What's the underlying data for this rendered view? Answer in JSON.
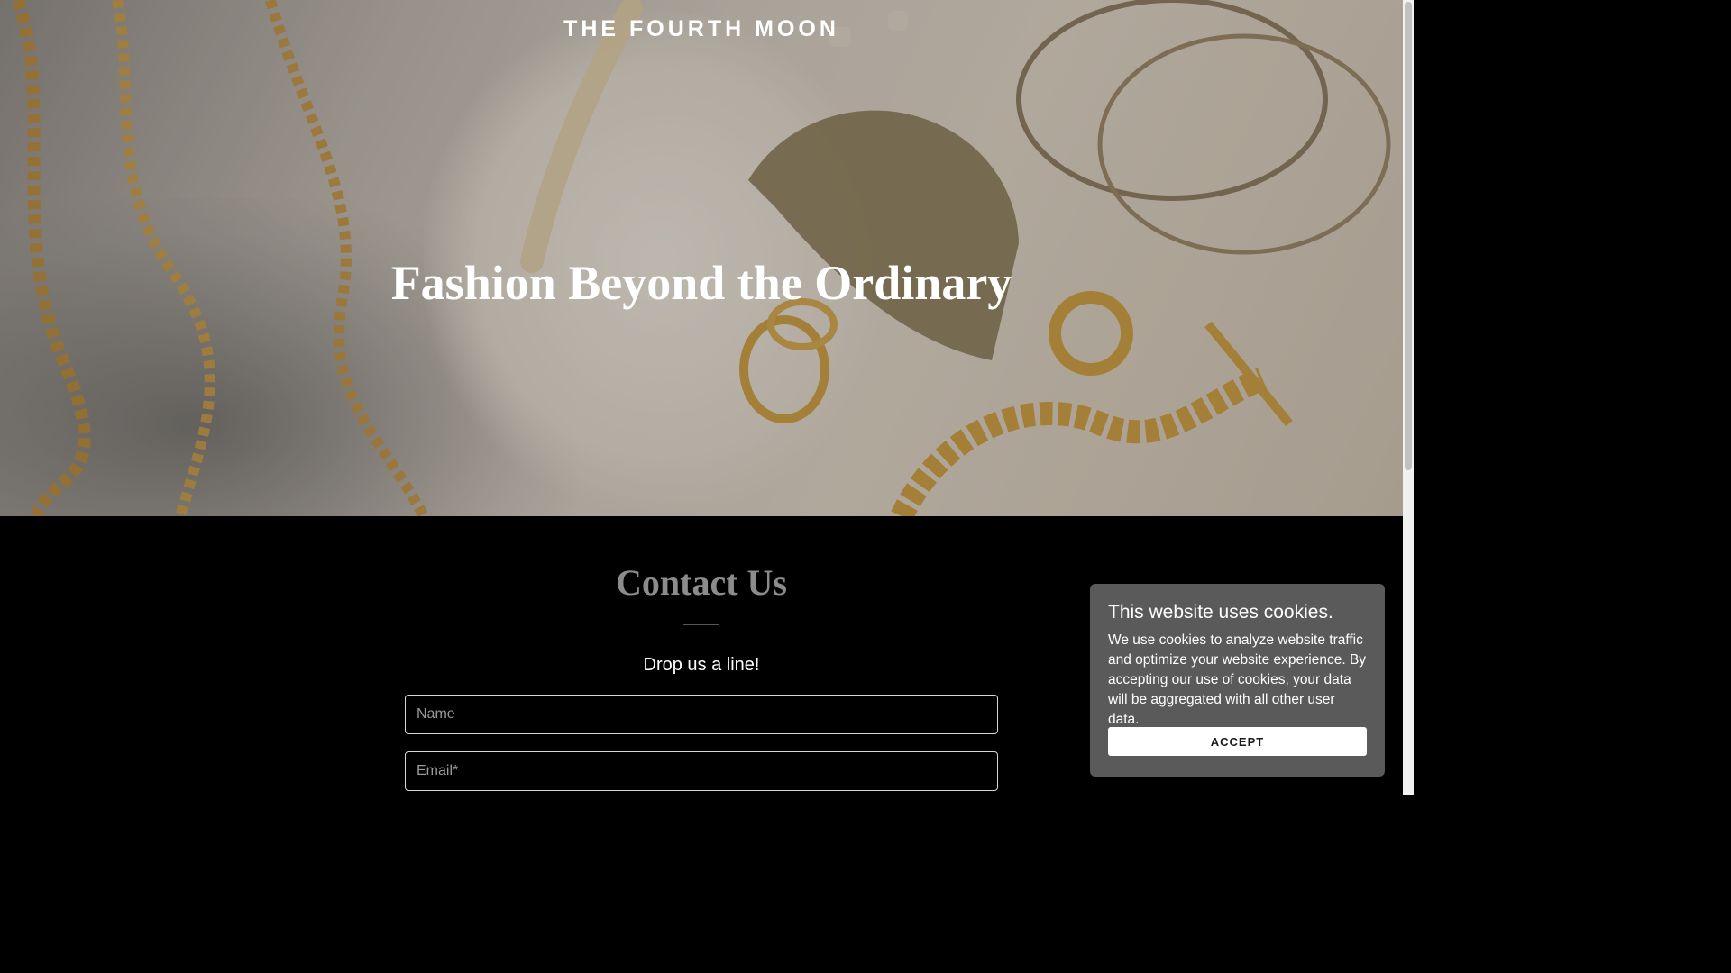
{
  "header": {
    "brand": "THE FOURTH MOON"
  },
  "hero": {
    "tagline": "Fashion Beyond the Ordinary"
  },
  "contact": {
    "title": "Contact Us",
    "subtitle": "Drop us a line!",
    "name_placeholder": "Name",
    "email_placeholder": "Email*"
  },
  "cookie_banner": {
    "title": "This website uses cookies.",
    "text": "We use cookies to analyze website traffic and optimize your website experience. By accepting our use of cookies, your data will be aggregated with all other user data.",
    "accept_label": "ACCEPT"
  }
}
